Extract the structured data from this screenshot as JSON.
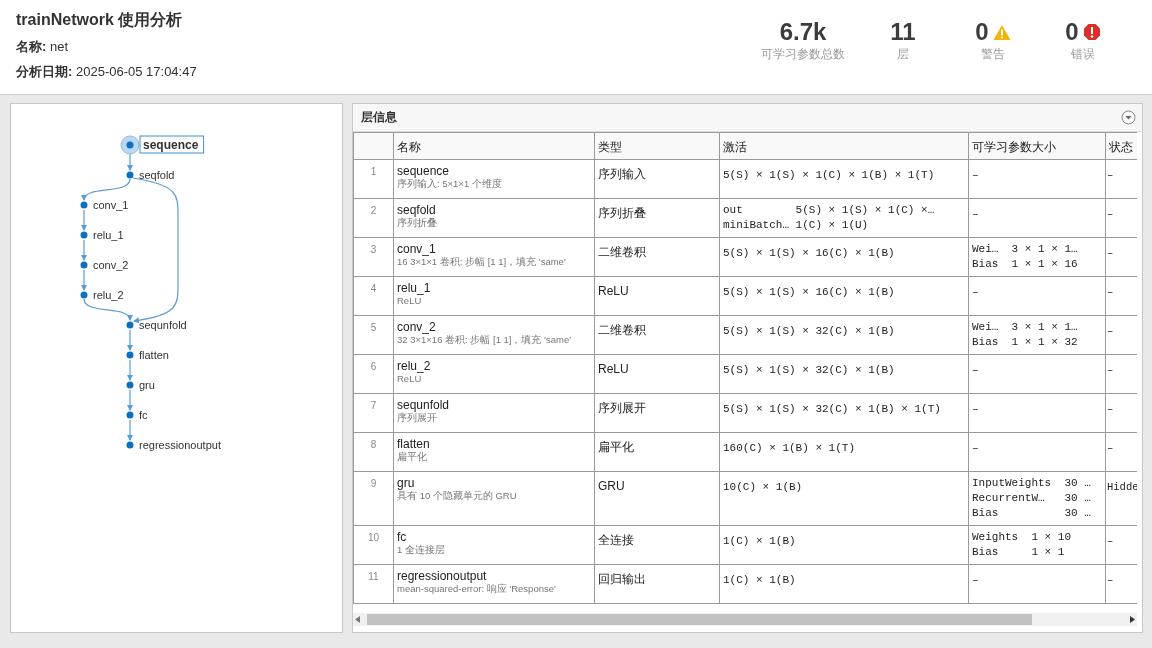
{
  "title": "trainNetwork 使用分析",
  "info": [
    "**名称:** net",
    "**分析日期:** 2025-06-05 17:04:47"
  ],
  "stats": [
    {
      "kind": "count",
      "value": "6.7k",
      "label": "可学习参数总数"
    },
    {
      "kind": "count",
      "value": "11",
      "label": "层"
    },
    {
      "kind": "warning",
      "value": "0",
      "label": "警告"
    },
    {
      "kind": "error",
      "value": "0",
      "label": "错误"
    }
  ],
  "graph": {
    "nodes": [
      {
        "label": "sequence",
        "kind": "main",
        "selected": true
      },
      {
        "label": "seqfold",
        "kind": "main",
        "selected": false
      },
      {
        "label": "conv_1",
        "kind": "branch",
        "selected": false
      },
      {
        "label": "relu_1",
        "kind": "branch",
        "selected": false
      },
      {
        "label": "conv_2",
        "kind": "branch",
        "selected": false
      },
      {
        "label": "relu_2",
        "kind": "branch",
        "selected": false
      },
      {
        "label": "sequnfold",
        "kind": "main",
        "selected": false
      },
      {
        "label": "flatten",
        "kind": "main",
        "selected": false
      },
      {
        "label": "gru",
        "kind": "main",
        "selected": false
      },
      {
        "label": "fc",
        "kind": "main",
        "selected": false
      },
      {
        "label": "regressionoutput",
        "kind": "main",
        "selected": false
      }
    ]
  },
  "layers": {
    "title": "层信息",
    "columns": [
      "名称",
      "类型",
      "激活",
      "可学习参数大小",
      "状态"
    ],
    "rows": [
      {
        "index": "1",
        "name": "sequence",
        "description": "序列输入: 5×1×1 个维度",
        "type": "序列输入",
        "activations": [
          "5(S) × 1(S) × 1(C) × 1(B) × 1(T)"
        ],
        "learnables": [
          "–"
        ],
        "state": "–"
      },
      {
        "index": "2",
        "name": "seqfold",
        "description": "序列折叠",
        "type": "序列折叠",
        "activations": [
          "out        5(S) × 1(S) × 1(C) ×…",
          "miniBatch… 1(C) × 1(U)"
        ],
        "learnables": [
          "–"
        ],
        "state": "–"
      },
      {
        "index": "3",
        "name": "conv_1",
        "description": "16 3×1×1 卷积: 步幅 [1 1]，填充 'same'",
        "type": "二维卷积",
        "activations": [
          "5(S) × 1(S) × 16(C) × 1(B)"
        ],
        "learnables": [
          "Wei…  3 × 1 × 1…",
          "Bias  1 × 1 × 16"
        ],
        "state": "–"
      },
      {
        "index": "4",
        "name": "relu_1",
        "description": "ReLU",
        "type": "ReLU",
        "activations": [
          "5(S) × 1(S) × 16(C) × 1(B)"
        ],
        "learnables": [
          "–"
        ],
        "state": "–"
      },
      {
        "index": "5",
        "name": "conv_2",
        "description": "32 3×1×16 卷积: 步幅 [1 1]，填充 'same'",
        "type": "二维卷积",
        "activations": [
          "5(S) × 1(S) × 32(C) × 1(B)"
        ],
        "learnables": [
          "Wei…  3 × 1 × 1…",
          "Bias  1 × 1 × 32"
        ],
        "state": "–"
      },
      {
        "index": "6",
        "name": "relu_2",
        "description": "ReLU",
        "type": "ReLU",
        "activations": [
          "5(S) × 1(S) × 32(C) × 1(B)"
        ],
        "learnables": [
          "–"
        ],
        "state": "–"
      },
      {
        "index": "7",
        "name": "sequnfold",
        "description": "序列展开",
        "type": "序列展开",
        "activations": [
          "5(S) × 1(S) × 32(C) × 1(B) × 1(T)"
        ],
        "learnables": [
          "–"
        ],
        "state": "–"
      },
      {
        "index": "8",
        "name": "flatten",
        "description": "扁平化",
        "type": "扁平化",
        "activations": [
          "160(C) × 1(B) × 1(T)"
        ],
        "learnables": [
          "–"
        ],
        "state": "–"
      },
      {
        "index": "9",
        "name": "gru",
        "description": "具有 10 个隐藏单元的 GRU",
        "type": "GRU",
        "activations": [
          "10(C) × 1(B)"
        ],
        "learnables": [
          "InputWeights  30 …",
          "RecurrentW…   30 …",
          "Bias          30 …"
        ],
        "state": "Hidde"
      },
      {
        "index": "10",
        "name": "fc",
        "description": "1 全连接层",
        "type": "全连接",
        "activations": [
          "1(C) × 1(B)"
        ],
        "learnables": [
          "Weights  1 × 10",
          "Bias     1 × 1"
        ],
        "state": "–"
      },
      {
        "index": "11",
        "name": "regressionoutput",
        "description": "mean-squared-error: 响应 'Response'",
        "type": "回归输出",
        "activations": [
          "1(C) × 1(B)"
        ],
        "learnables": [
          "–"
        ],
        "state": "–"
      }
    ]
  }
}
